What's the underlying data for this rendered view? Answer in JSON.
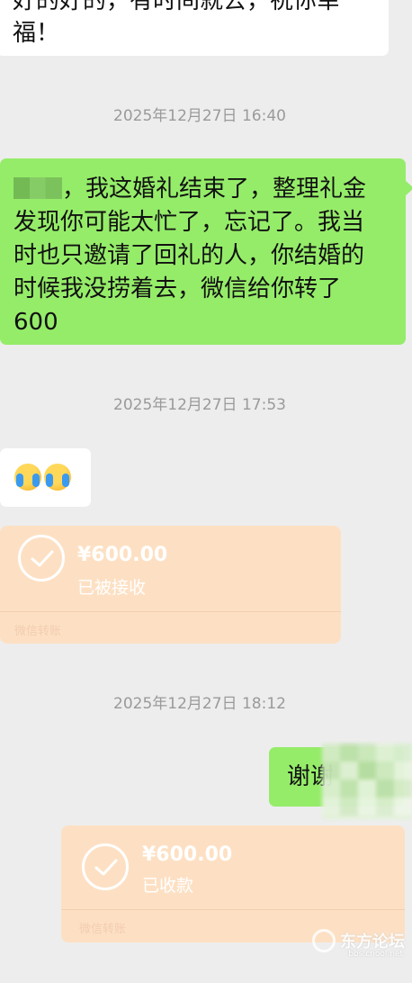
{
  "messages": {
    "prev_incoming": {
      "line1": "好的好的，有时间就去，祝你幸",
      "line2": "福！"
    },
    "time1": "2025年12月27日 16:40",
    "outgoing1": {
      "prefix": "，我这婚礼结束了，整理礼金",
      "line2": "发现你可能太忙了，忘记了。我当",
      "line3": "时也只邀请了回礼的人，你结婚的",
      "line4": "时候我没捞着去，微信给你转了",
      "line5": "600"
    },
    "time2": "2025年12月27日 17:53",
    "incoming_emoji": {
      "emoji_icon": "crying-face-icon",
      "count": 2
    },
    "transfer1": {
      "amount": "¥600.00",
      "status": "已被接收",
      "footer": "微信转账"
    },
    "time3": "2025年12月27日 18:12",
    "outgoing2": {
      "text": "谢谢"
    },
    "transfer2": {
      "amount": "¥600.00",
      "status": "已收款",
      "footer": "微信转账"
    }
  },
  "watermark": {
    "name": "东方论坛",
    "url": "bbs.cnool.net"
  },
  "colors": {
    "background": "#ededed",
    "outgoing_bubble": "#95ec69",
    "incoming_bubble": "#ffffff",
    "transfer_card": "#fde0c3",
    "timestamp_text": "#9a9a9a"
  }
}
